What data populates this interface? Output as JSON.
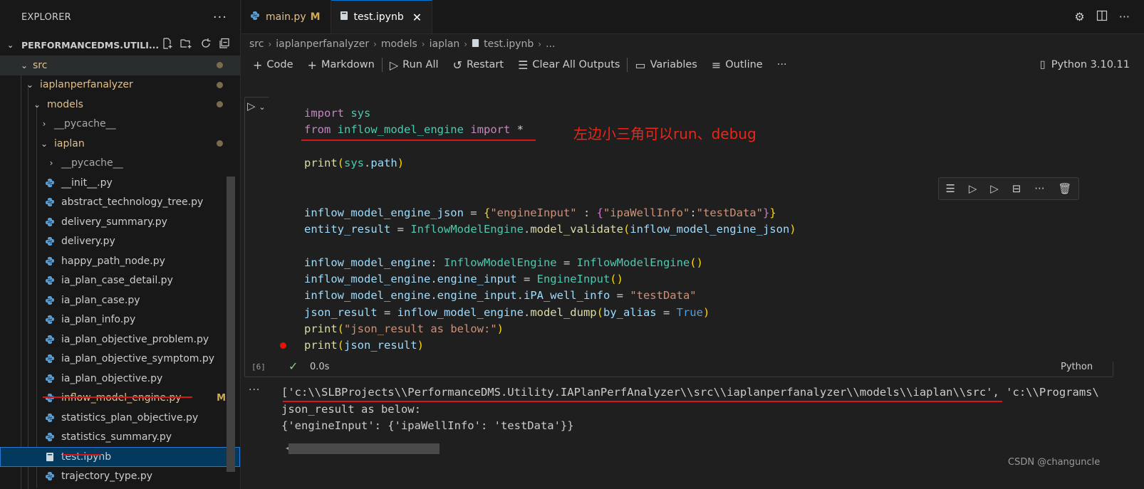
{
  "sidebar": {
    "title": "EXPLORER",
    "more": "···",
    "root_label": "PERFORMANCEDMS.UTILI...",
    "items": [
      {
        "label": "src",
        "kind": "folder"
      },
      {
        "label": "iaplanperfanalyzer",
        "kind": "folder"
      },
      {
        "label": "models",
        "kind": "folder"
      },
      {
        "label": "__pycache__",
        "kind": "folder"
      },
      {
        "label": "iaplan",
        "kind": "folder"
      },
      {
        "label": "__pycache__",
        "kind": "folder"
      },
      {
        "label": "__init__.py",
        "kind": "py"
      },
      {
        "label": "abstract_technology_tree.py",
        "kind": "py"
      },
      {
        "label": "delivery_summary.py",
        "kind": "py"
      },
      {
        "label": "delivery.py",
        "kind": "py"
      },
      {
        "label": "happy_path_node.py",
        "kind": "py"
      },
      {
        "label": "ia_plan_case_detail.py",
        "kind": "py"
      },
      {
        "label": "ia_plan_case.py",
        "kind": "py"
      },
      {
        "label": "ia_plan_info.py",
        "kind": "py"
      },
      {
        "label": "ia_plan_objective_problem.py",
        "kind": "py"
      },
      {
        "label": "ia_plan_objective_symptom.py",
        "kind": "py"
      },
      {
        "label": "ia_plan_objective.py",
        "kind": "py"
      },
      {
        "label": "inflow_model_engine.py",
        "kind": "py",
        "badge": "M"
      },
      {
        "label": "statistics_plan_objective.py",
        "kind": "py"
      },
      {
        "label": "statistics_summary.py",
        "kind": "py"
      },
      {
        "label": "test.ipynb",
        "kind": "nb"
      },
      {
        "label": "trajectory_type.py",
        "kind": "py"
      }
    ]
  },
  "tabs": [
    {
      "label": "main.py",
      "badge": "M"
    },
    {
      "label": "test.ipynb",
      "close": "✕"
    }
  ],
  "breadcrumb": [
    "src",
    "iaplanperfanalyzer",
    "models",
    "iaplan",
    "test.ipynb",
    "..."
  ],
  "toolbar": {
    "code": "Code",
    "markdown": "Markdown",
    "run_all": "Run All",
    "restart": "Restart",
    "clear": "Clear All Outputs",
    "variables": "Variables",
    "outline": "Outline",
    "more": "···",
    "kernel": "Python 3.10.11"
  },
  "cell": {
    "exec_count": "[6]",
    "time": "0.0s",
    "language": "Python",
    "annotation": "左边小三角可以run、debug"
  },
  "output": {
    "line1": "['c:\\\\SLBProjects\\\\PerformanceDMS.Utility.IAPlanPerfAnalyzer\\\\src\\\\iaplanperfanalyzer\\\\models\\\\iaplan\\\\src', 'c:\\\\Programs\\",
    "line2": "json_result as below:",
    "line3": "{'engineInput': {'ipaWellInfo': 'testData'}}"
  },
  "watermark": "CSDN @changuncle",
  "colors": {
    "accent": "#0078d4",
    "selection": "#04395e",
    "annotation_red": "#d7161b",
    "modified": "#d2a94f"
  }
}
